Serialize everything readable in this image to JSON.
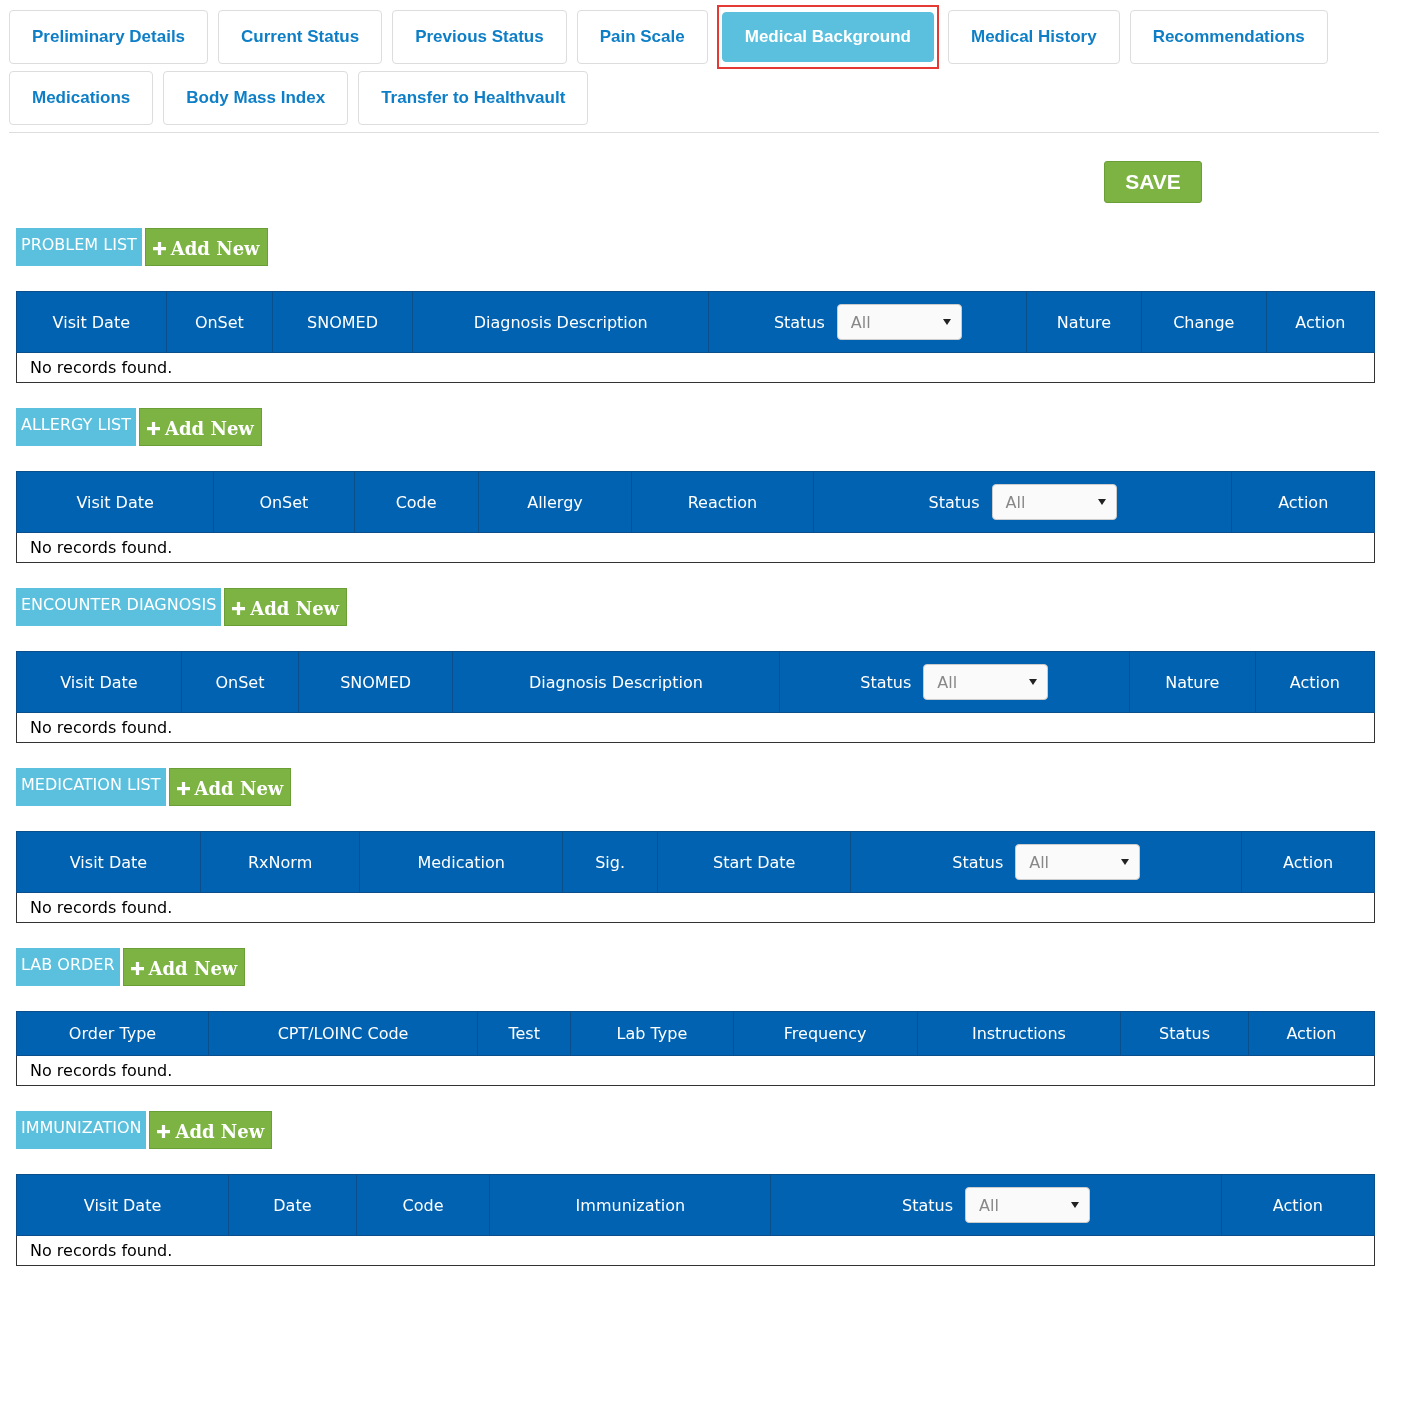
{
  "tabs": [
    {
      "label": "Preliminary Details",
      "selected": false
    },
    {
      "label": "Current Status",
      "selected": false
    },
    {
      "label": "Previous Status",
      "selected": false
    },
    {
      "label": "Pain Scale",
      "selected": false
    },
    {
      "label": "Medical Background",
      "selected": true
    },
    {
      "label": "Medical History",
      "selected": false
    },
    {
      "label": "Recommendations",
      "selected": false
    },
    {
      "label": "Medications",
      "selected": false
    },
    {
      "label": "Body Mass Index",
      "selected": false
    },
    {
      "label": "Transfer to Healthvault",
      "selected": false
    }
  ],
  "save_button": "SAVE",
  "sections": [
    {
      "title": "PROBLEM LIST",
      "add_button": "Add New",
      "columns": [
        {
          "kind": "text",
          "label": "Visit Date"
        },
        {
          "kind": "text",
          "label": "OnSet"
        },
        {
          "kind": "text",
          "label": "SNOMED"
        },
        {
          "kind": "text",
          "label": "Diagnosis Description"
        },
        {
          "kind": "filter",
          "label": "Status",
          "value": "All"
        },
        {
          "kind": "text",
          "label": "Nature"
        },
        {
          "kind": "text",
          "label": "Change"
        },
        {
          "kind": "text",
          "label": "Action"
        }
      ],
      "empty_text": "No records found."
    },
    {
      "title": "ALLERGY LIST",
      "add_button": "Add New",
      "columns": [
        {
          "kind": "text",
          "label": "Visit Date"
        },
        {
          "kind": "text",
          "label": "OnSet"
        },
        {
          "kind": "text",
          "label": "Code"
        },
        {
          "kind": "text",
          "label": "Allergy"
        },
        {
          "kind": "text",
          "label": "Reaction"
        },
        {
          "kind": "filter",
          "label": "Status",
          "value": "All"
        },
        {
          "kind": "text",
          "label": "Action"
        }
      ],
      "empty_text": "No records found."
    },
    {
      "title": "ENCOUNTER DIAGNOSIS",
      "add_button": "Add New",
      "columns": [
        {
          "kind": "text",
          "label": "Visit Date"
        },
        {
          "kind": "text",
          "label": "OnSet"
        },
        {
          "kind": "text",
          "label": "SNOMED"
        },
        {
          "kind": "text",
          "label": "Diagnosis Description"
        },
        {
          "kind": "filter",
          "label": "Status",
          "value": "All"
        },
        {
          "kind": "text",
          "label": "Nature"
        },
        {
          "kind": "text",
          "label": "Action"
        }
      ],
      "empty_text": "No records found."
    },
    {
      "title": "MEDICATION LIST",
      "add_button": "Add New",
      "columns": [
        {
          "kind": "text",
          "label": "Visit Date"
        },
        {
          "kind": "text",
          "label": "RxNorm"
        },
        {
          "kind": "text",
          "label": "Medication"
        },
        {
          "kind": "text",
          "label": "Sig."
        },
        {
          "kind": "text",
          "label": "Start Date"
        },
        {
          "kind": "filter",
          "label": "Status",
          "value": "All"
        },
        {
          "kind": "text",
          "label": "Action"
        }
      ],
      "empty_text": "No records found."
    },
    {
      "title": "LAB ORDER",
      "add_button": "Add New",
      "columns": [
        {
          "kind": "text",
          "label": "Order Type"
        },
        {
          "kind": "text",
          "label": "CPT/LOINC Code"
        },
        {
          "kind": "text",
          "label": "Test"
        },
        {
          "kind": "text",
          "label": "Lab Type"
        },
        {
          "kind": "text",
          "label": "Frequency"
        },
        {
          "kind": "text",
          "label": "Instructions"
        },
        {
          "kind": "text",
          "label": "Status"
        },
        {
          "kind": "text",
          "label": "Action"
        }
      ],
      "empty_text": "No records found."
    },
    {
      "title": "IMMUNIZATION",
      "add_button": "Add New",
      "columns": [
        {
          "kind": "text",
          "label": "Visit Date"
        },
        {
          "kind": "text",
          "label": "Date"
        },
        {
          "kind": "text",
          "label": "Code"
        },
        {
          "kind": "text",
          "label": "Immunization"
        },
        {
          "kind": "filter",
          "label": "Status",
          "value": "All"
        },
        {
          "kind": "text",
          "label": "Action"
        }
      ],
      "empty_text": "No records found."
    }
  ]
}
